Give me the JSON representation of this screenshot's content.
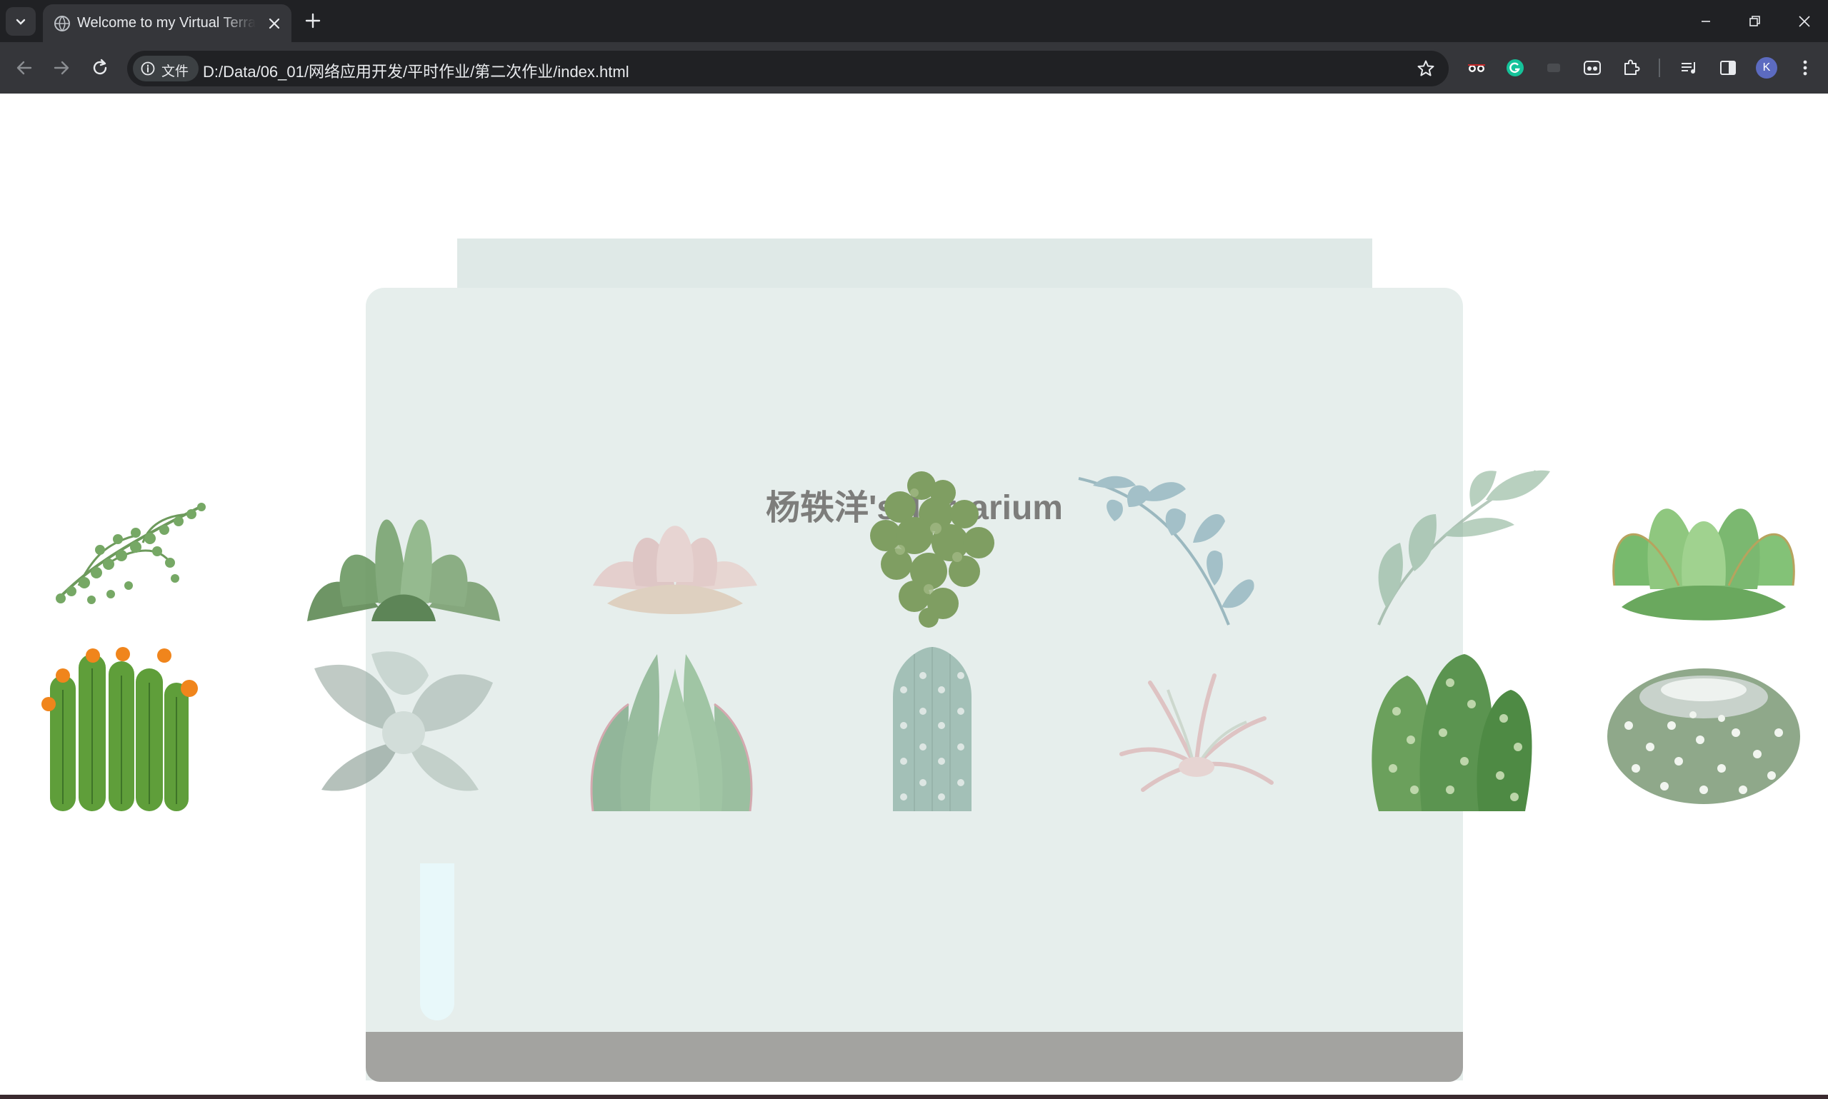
{
  "browser": {
    "tab_title": "Welcome to my Virtual Terrarium",
    "chip_label": "文件",
    "url": "D:/Data/06_01/网络应用开发/平时作业/第二次作业/index.html",
    "profile_initial": "K"
  },
  "page": {
    "title": "杨轶洋's Terrarium"
  },
  "plants": [
    {
      "name": "string-of-pearls"
    },
    {
      "name": "green-echeveria"
    },
    {
      "name": "pink-succulent"
    },
    {
      "name": "clustered-sedum"
    },
    {
      "name": "blue-eucalyptus-branch"
    },
    {
      "name": "sage-leaf-branch"
    },
    {
      "name": "jade-rosette"
    },
    {
      "name": "flowering-cactus"
    },
    {
      "name": "silver-echeveria"
    },
    {
      "name": "aloe-rosette"
    },
    {
      "name": "column-cactus"
    },
    {
      "name": "air-plant"
    },
    {
      "name": "prickly-pear"
    },
    {
      "name": "fuzzy-ball-cactus"
    }
  ],
  "colors": {
    "tabbar": "#202124",
    "toolbar": "#35363a",
    "jar": "#e6eeec",
    "jar_top": "#dfe9e7",
    "dirt": "#a3a3a0",
    "title": "#7d7d7b"
  }
}
